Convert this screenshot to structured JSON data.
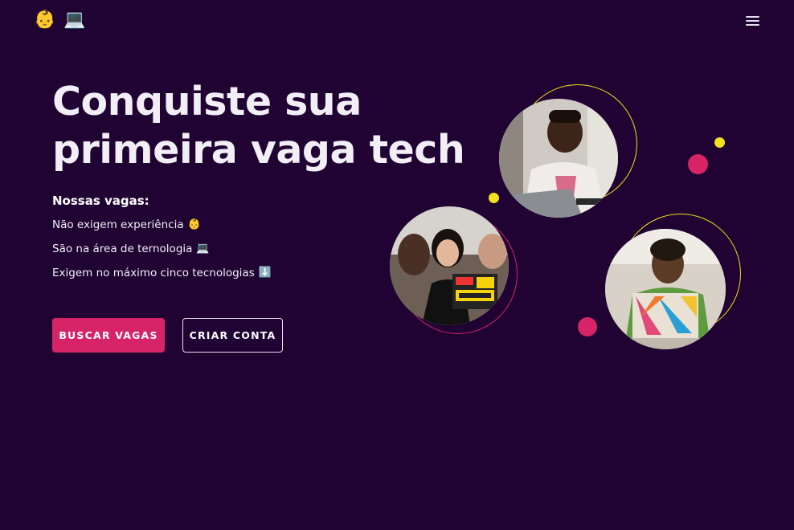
{
  "header": {
    "logo_emoji_1": "👶",
    "logo_emoji_2": "💻",
    "menu_icon": "hamburger-menu-icon"
  },
  "hero": {
    "title_line_1": "Conquiste sua",
    "title_line_2": "primeira vaga tech",
    "features_heading": "Nossas vagas:",
    "features": [
      {
        "text": "Não exigem experiência",
        "emoji": "👶"
      },
      {
        "text": "São na área de ternologia",
        "emoji": "💻"
      },
      {
        "text": "Exigem no máximo cinco tecnologias",
        "emoji": "⬇️"
      }
    ],
    "primary_button": "BUSCAR VAGAS",
    "secondary_button": "CRIAR CONTA"
  },
  "colors": {
    "background": "#200333",
    "accent_pink": "#d62466",
    "accent_yellow": "#f5e01c",
    "text": "#ffffff"
  }
}
